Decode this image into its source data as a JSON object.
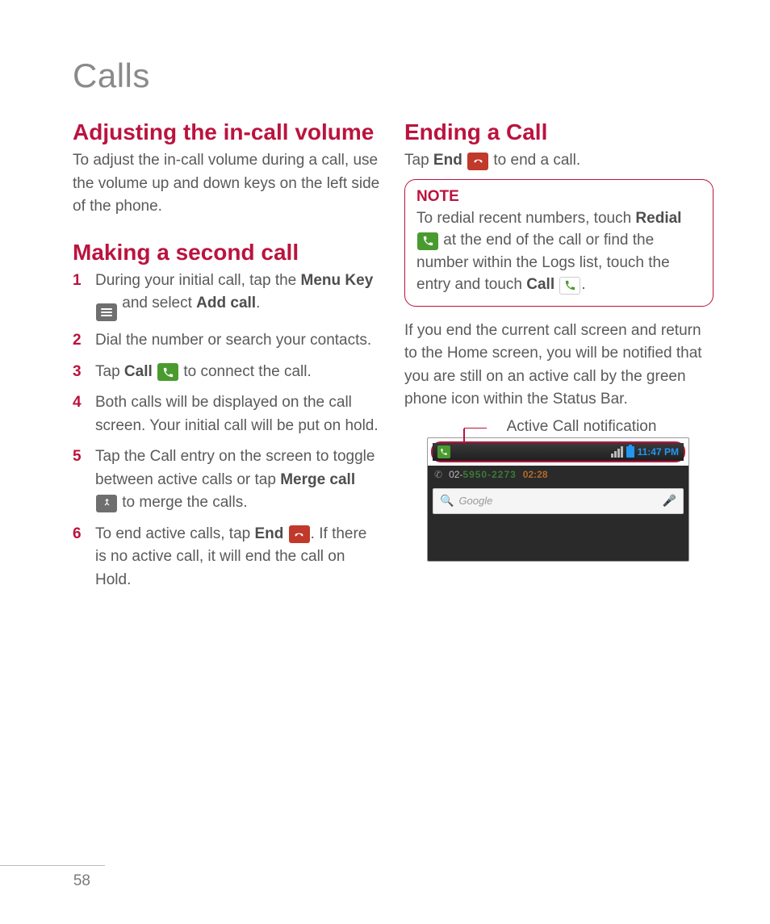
{
  "page_number": "58",
  "chapter": "Calls",
  "left": {
    "h1": "Adjusting the in-call volume",
    "p1": "To adjust the in-call volume during a call, use the volume up and down keys on the left side of the phone.",
    "h2": "Making a second call",
    "steps": {
      "s1a": "During your initial call, tap the ",
      "s1_menu": "Menu Key",
      "s1b": " and select ",
      "s1_add": "Add call",
      "s1c": ".",
      "s2": "Dial the number or search your contacts.",
      "s3a": "Tap ",
      "s3_call": "Call",
      "s3b": " to connect the call.",
      "s4": "Both calls will be displayed on the call screen. Your initial call will be put on hold.",
      "s5a": "Tap the Call entry on the screen to toggle between active calls or tap ",
      "s5_merge": "Merge call",
      "s5b": " to merge the calls.",
      "s6a": "To end active calls, tap ",
      "s6_end": "End",
      "s6b": ". If there is no active call, it will end the call on Hold."
    }
  },
  "right": {
    "h1": "Ending a Call",
    "p1a": "Tap ",
    "p1_end": "End",
    "p1b": " to end a call.",
    "note": {
      "label": "NOTE",
      "t1": "To redial recent numbers, touch ",
      "redial": "Redial",
      "t2": " at the end of the call or find the number within the Logs list, touch the entry and touch ",
      "call": "Call",
      "t3": "."
    },
    "p2": "If you end the current call screen and return to the Home screen, you will be notified that you are still on an active call by the green phone icon within the Status Bar.",
    "callout": "Active Call notification",
    "shot": {
      "time": "11:47 PM",
      "call_prefix": "02-",
      "call_num": "5950-2273",
      "duration": "02:28",
      "search_placeholder": "Google"
    }
  }
}
